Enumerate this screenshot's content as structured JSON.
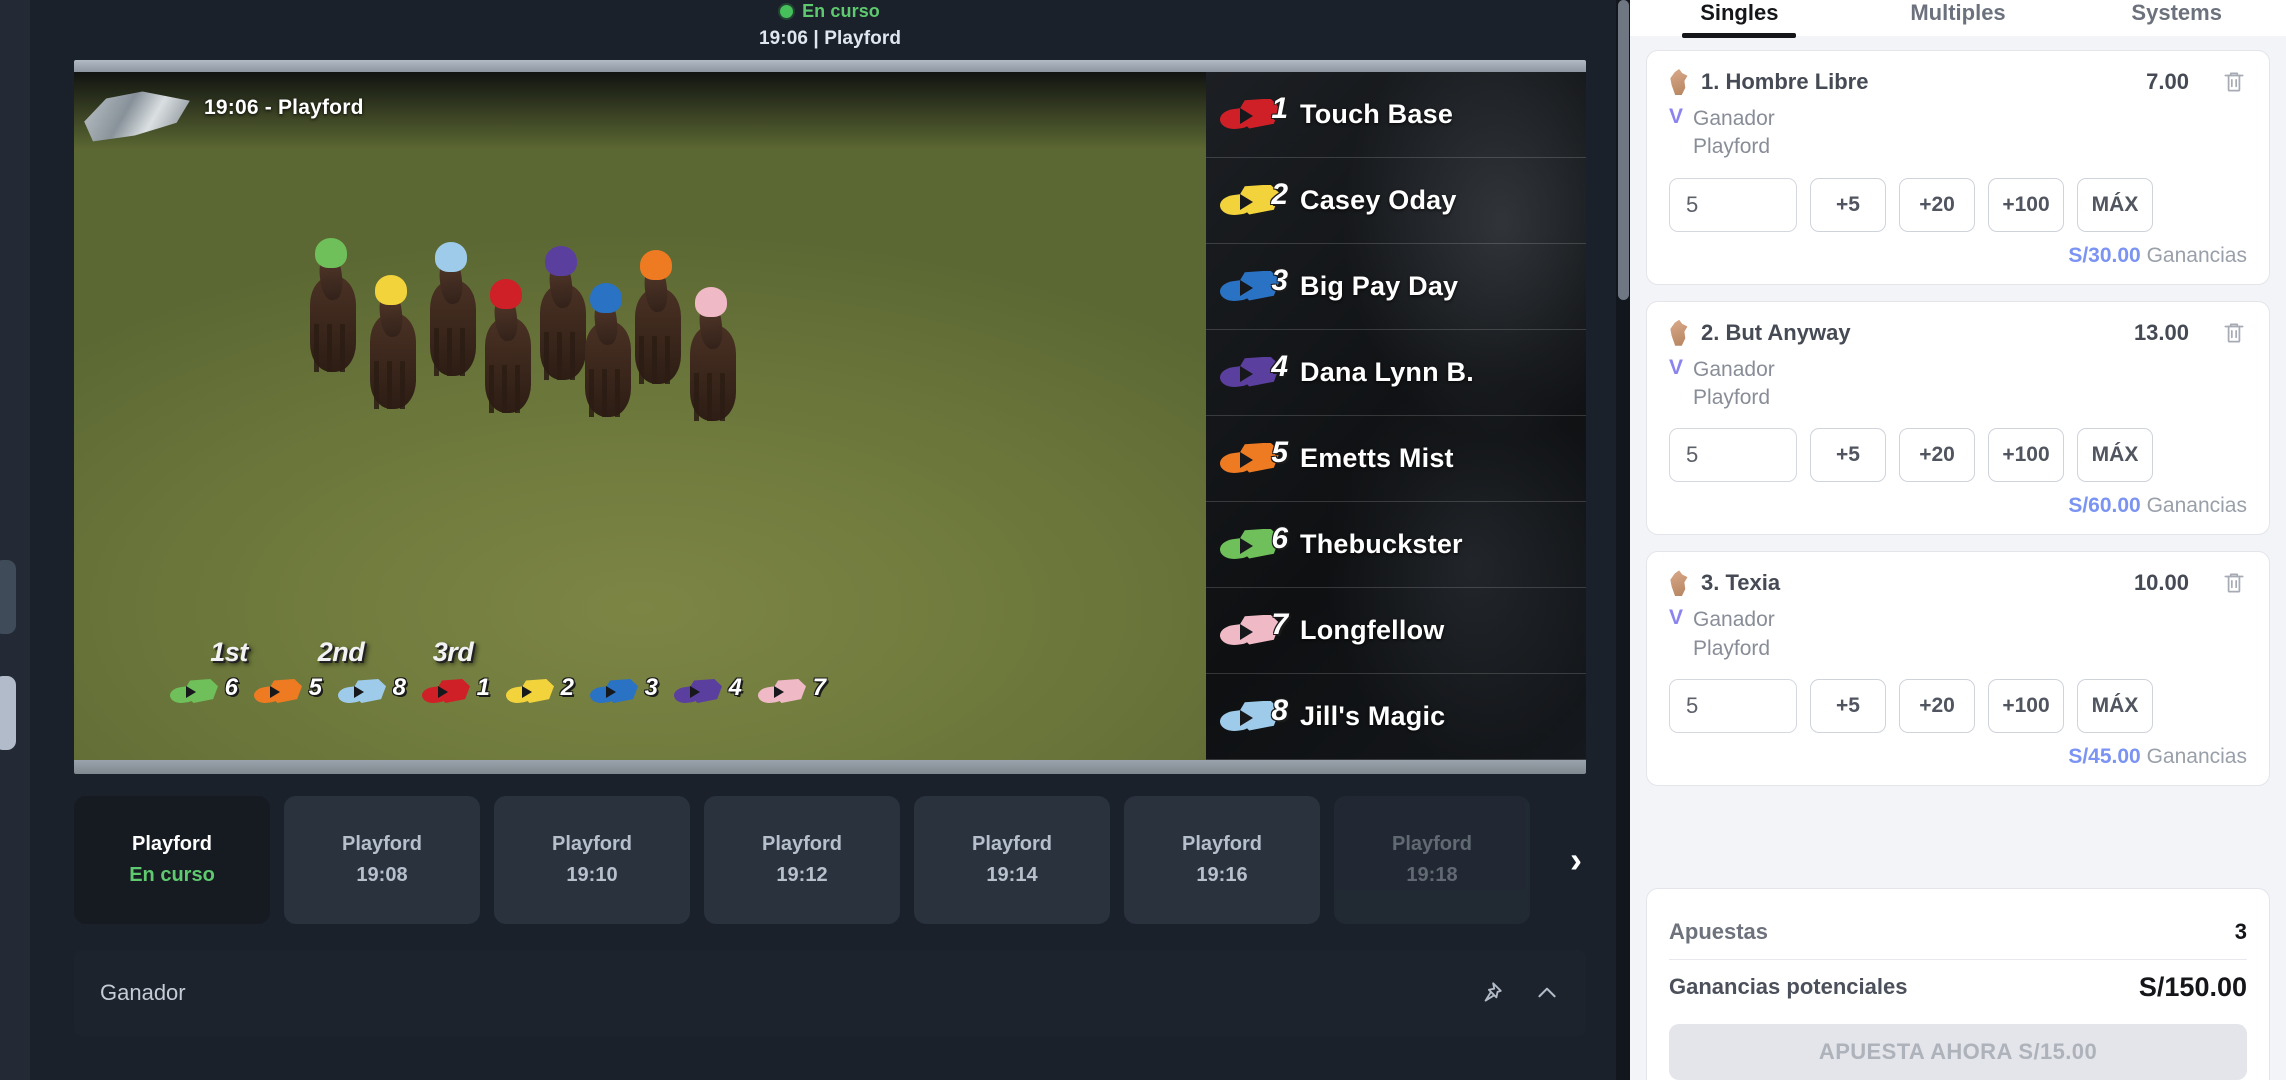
{
  "event": {
    "status_label": "En curso",
    "status_color": "#5fc96f",
    "subtitle": "19:06 | Playford"
  },
  "video": {
    "overlay_title": "19:06 - Playford",
    "positions": {
      "labels": [
        "1st",
        "2nd",
        "3rd"
      ],
      "order": [
        {
          "number": "6",
          "color": "#6fbf5a"
        },
        {
          "number": "5",
          "color": "#ee7a22"
        },
        {
          "number": "8",
          "color": "#9ecbea"
        },
        {
          "number": "1",
          "color": "#cf2028"
        },
        {
          "number": "2",
          "color": "#f2d33c"
        },
        {
          "number": "3",
          "color": "#2a72c4"
        },
        {
          "number": "4",
          "color": "#5b3f9e"
        },
        {
          "number": "7",
          "color": "#efbac6"
        }
      ]
    }
  },
  "runners": [
    {
      "number": "1",
      "name": "Touch Base",
      "color": "#cf2028"
    },
    {
      "number": "2",
      "name": "Casey Oday",
      "color": "#f2d33c"
    },
    {
      "number": "3",
      "name": "Big Pay Day",
      "color": "#2a72c4"
    },
    {
      "number": "4",
      "name": "Dana Lynn B.",
      "color": "#5b3f9e"
    },
    {
      "number": "5",
      "name": "Emetts Mist",
      "color": "#ee7a22"
    },
    {
      "number": "6",
      "name": "Thebuckster",
      "color": "#6fbf5a"
    },
    {
      "number": "7",
      "name": "Longfellow",
      "color": "#efbac6"
    },
    {
      "number": "8",
      "name": "Jill's Magic",
      "color": "#9ecbea"
    }
  ],
  "race_tabs": [
    {
      "venue": "Playford",
      "time": "En curso",
      "active": true,
      "faded": false
    },
    {
      "venue": "Playford",
      "time": "19:08",
      "active": false,
      "faded": false
    },
    {
      "venue": "Playford",
      "time": "19:10",
      "active": false,
      "faded": false
    },
    {
      "venue": "Playford",
      "time": "19:12",
      "active": false,
      "faded": false
    },
    {
      "venue": "Playford",
      "time": "19:14",
      "active": false,
      "faded": false
    },
    {
      "venue": "Playford",
      "time": "19:16",
      "active": false,
      "faded": false
    },
    {
      "venue": "Playford",
      "time": "19:18",
      "active": false,
      "faded": true
    }
  ],
  "strip": {
    "next_arrow": "›"
  },
  "market": {
    "title": "Ganador"
  },
  "betslip": {
    "tabs": [
      {
        "label": "Singles",
        "active": true
      },
      {
        "label": "Multiples",
        "active": false
      },
      {
        "label": "Systems",
        "active": false
      }
    ],
    "bets": [
      {
        "selection": "1. Hombre Libre",
        "odds": "7.00",
        "market": "Ganador",
        "event": "Playford",
        "stake": "5",
        "quick": [
          "+5",
          "+20",
          "+100",
          "MÁX"
        ],
        "winnings_amount": "S/30.00",
        "winnings_label": "Ganancias"
      },
      {
        "selection": "2. But Anyway",
        "odds": "13.00",
        "market": "Ganador",
        "event": "Playford",
        "stake": "5",
        "quick": [
          "+5",
          "+20",
          "+100",
          "MÁX"
        ],
        "winnings_amount": "S/60.00",
        "winnings_label": "Ganancias"
      },
      {
        "selection": "3. Texia",
        "odds": "10.00",
        "market": "Ganador",
        "event": "Playford",
        "stake": "5",
        "quick": [
          "+5",
          "+20",
          "+100",
          "MÁX"
        ],
        "winnings_amount": "S/45.00",
        "winnings_label": "Ganancias"
      }
    ],
    "summary": {
      "bets_label": "Apuestas",
      "bets_count": "3",
      "potential_label": "Ganancias potenciales",
      "potential_value": "S/150.00",
      "place_button": "APUESTA AHORA S/15.00"
    }
  }
}
